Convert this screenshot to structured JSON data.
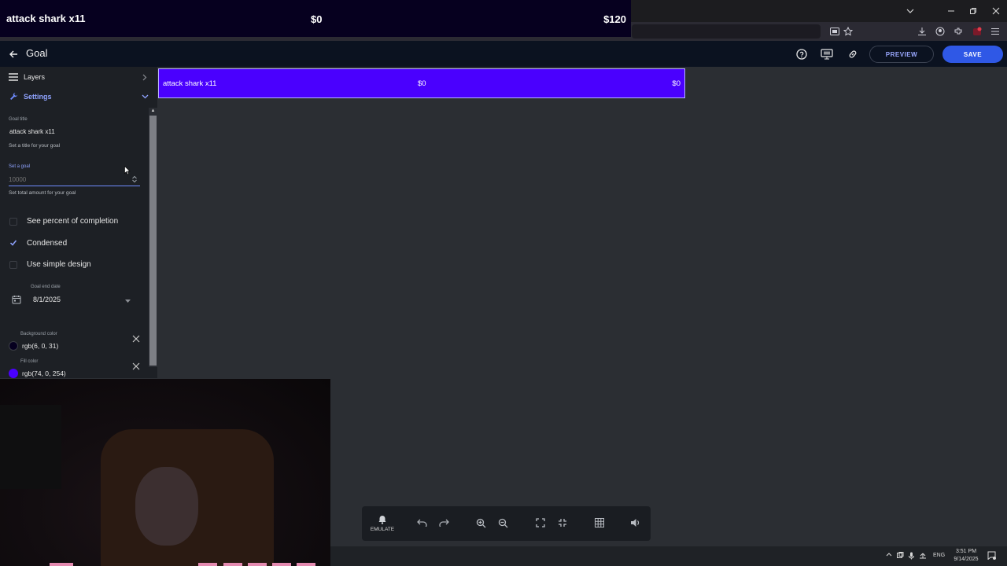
{
  "overlay_preview": {
    "title": "attack shark x11",
    "current": "$0",
    "goal": "$120"
  },
  "header": {
    "title": "Goal",
    "preview_label": "PREVIEW",
    "save_label": "SAVE"
  },
  "sidebar": {
    "layers_label": "Layers",
    "settings_label": "Settings",
    "goal_title": {
      "label": "Goal title",
      "value": "attack shark x11",
      "helper": "Set a title for your goal"
    },
    "goal_amount": {
      "label": "Set a goal",
      "placeholder": "10000",
      "helper": "Set total amount for your goal"
    },
    "checkboxes": [
      {
        "label": "See percent of completion",
        "checked": false
      },
      {
        "label": "Condensed",
        "checked": true
      },
      {
        "label": "Use simple design",
        "checked": false
      }
    ],
    "end_date": {
      "label": "Goal end date",
      "value": "8/1/2025"
    },
    "background_color": {
      "label": "Background color",
      "value": "rgb(6, 0, 31)",
      "swatch": "#06001f"
    },
    "fill_color": {
      "label": "Fill color",
      "value": "rgb(74, 0, 254)",
      "swatch": "#4a00fe"
    }
  },
  "goal_widget": {
    "title": "attack shark x11",
    "current": "$0",
    "goal": "$0",
    "fill": "#4a00fe"
  },
  "bottom_toolbar": {
    "emulate_label": "EMULATE",
    "icons": [
      "bell-icon",
      "undo-icon",
      "redo-icon",
      "zoom-in-icon",
      "zoom-out-icon",
      "fullscreen-icon",
      "exit-fullscreen-icon",
      "grid-icon",
      "volume-icon"
    ]
  },
  "taskbar": {
    "language": "ENG",
    "time": "3:51 PM",
    "date": "9/14/2025"
  },
  "colors": {
    "accent": "#2f58e6",
    "header_bg": "#0b1220",
    "sidebar_bg": "#1d2025",
    "canvas_bg": "#2b2e33"
  }
}
